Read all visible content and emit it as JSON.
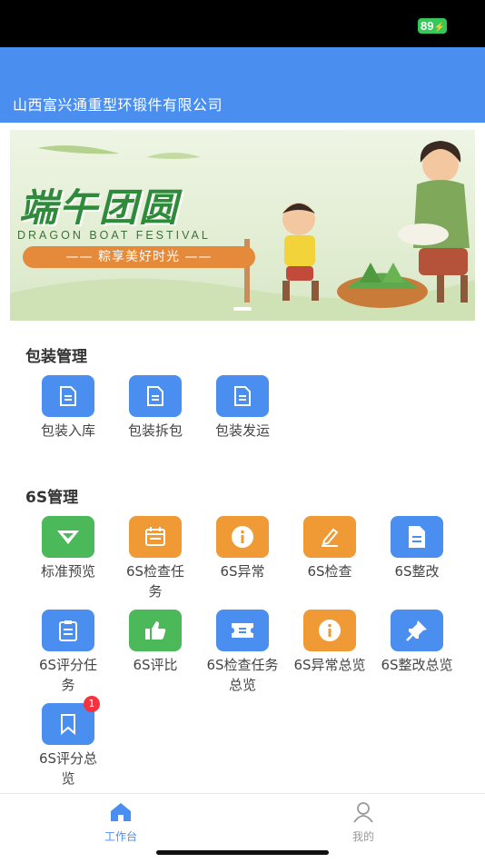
{
  "status_bar": {
    "battery": "89"
  },
  "header": {
    "title": "山西富兴通重型环锻件有限公司"
  },
  "banner": {
    "title": "端午团圆",
    "subtitle": "DRAGON BOAT FESTIVAL",
    "pill": "—— 粽享美好时光 ——"
  },
  "sections": [
    {
      "title": "包装管理",
      "items": [
        {
          "label": "包装入库",
          "icon": "document-icon",
          "color": "#4a8ef0"
        },
        {
          "label": "包装拆包",
          "icon": "document-icon",
          "color": "#4a8ef0"
        },
        {
          "label": "包装发运",
          "icon": "document-icon",
          "color": "#4a8ef0"
        }
      ]
    },
    {
      "title": "6S管理",
      "items": [
        {
          "label": "标准预览",
          "icon": "diamond-icon",
          "color": "#4bb85a"
        },
        {
          "label": "6S检查任务",
          "icon": "calendar-icon",
          "color": "#ef9a35"
        },
        {
          "label": "6S异常",
          "icon": "info-icon",
          "color": "#ef9a35"
        },
        {
          "label": "6S检查",
          "icon": "edit-icon",
          "color": "#ef9a35"
        },
        {
          "label": "6S整改",
          "icon": "file-icon",
          "color": "#4a8ef0"
        },
        {
          "label": "6S评分任务",
          "icon": "clipboard-icon",
          "color": "#4a8ef0"
        },
        {
          "label": "6S评比",
          "icon": "thumbs-up-icon",
          "color": "#4bb85a"
        },
        {
          "label": "6S检查任务总览",
          "icon": "ticket-icon",
          "color": "#4a8ef0"
        },
        {
          "label": "6S异常总览",
          "icon": "info-icon",
          "color": "#ef9a35"
        },
        {
          "label": "6S整改总览",
          "icon": "pin-icon",
          "color": "#4a8ef0"
        },
        {
          "label": "6S评分总览",
          "icon": "bookmark-icon",
          "color": "#4a8ef0",
          "badge": "1"
        }
      ]
    }
  ],
  "tabbar": {
    "tabs": [
      {
        "label": "工作台",
        "icon": "home-icon",
        "active": true,
        "color": "#4a8ef0"
      },
      {
        "label": "我的",
        "icon": "user-icon",
        "active": false,
        "color": "#999999"
      }
    ]
  }
}
